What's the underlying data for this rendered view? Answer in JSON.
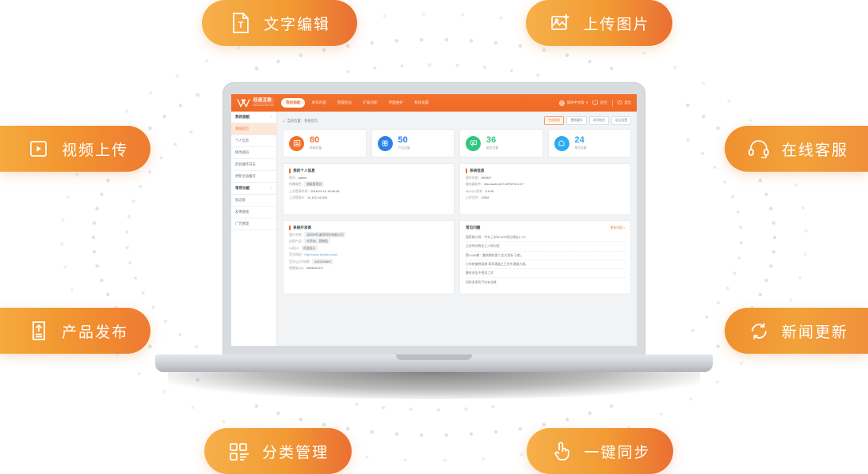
{
  "features": [
    {
      "id": "text-edit",
      "label": "文字编辑",
      "icon": "text-file-icon",
      "position": "top-left"
    },
    {
      "id": "image-upload",
      "label": "上传图片",
      "icon": "image-plus-icon",
      "position": "top-right"
    },
    {
      "id": "video-upload",
      "label": "视频上传",
      "icon": "video-play-icon",
      "position": "mid-left-upper"
    },
    {
      "id": "online-service",
      "label": "在线客服",
      "icon": "headset-icon",
      "position": "mid-right-upper"
    },
    {
      "id": "product-publish",
      "label": "产品发布",
      "icon": "upload-doc-icon",
      "position": "mid-left-lower"
    },
    {
      "id": "news-update",
      "label": "新闻更新",
      "icon": "refresh-sync-icon",
      "position": "mid-right-lower"
    },
    {
      "id": "category-manage",
      "label": "分类管理",
      "icon": "grid-list-icon",
      "position": "bottom-left"
    },
    {
      "id": "one-key-sync",
      "label": "一键同步",
      "icon": "click-hand-icon",
      "position": "bottom-right"
    }
  ],
  "colors": {
    "pill_start": "#f6b04a",
    "pill_end": "#ea6f33",
    "brand_orange": "#f4712c",
    "card_orange": "#f4712c",
    "card_blue": "#2f7fe8",
    "card_green": "#2fc77e",
    "card_cyan": "#2aaaf0"
  },
  "dashboard": {
    "logo": {
      "cn": "旺道互联",
      "en": "WANGDAOHULIAN",
      "mark": "w-logo-icon"
    },
    "nav": {
      "items": [
        {
          "label": "我的面板",
          "active": true
        },
        {
          "label": "发布内容",
          "active": false
        },
        {
          "label": "管理会员",
          "active": false
        },
        {
          "label": "扩展功能",
          "active": false
        },
        {
          "label": "界面维护",
          "active": false
        },
        {
          "label": "系统设置",
          "active": false
        }
      ],
      "right": [
        {
          "label": "简体中文版",
          "icon": "globe-icon",
          "caret": "▾"
        },
        {
          "label": "前台",
          "icon": "monitor-icon"
        },
        {
          "label": "退出",
          "icon": "power-icon"
        }
      ]
    },
    "sidebar": [
      {
        "type": "group",
        "label": "我的面板",
        "chevron": "⌃"
      },
      {
        "type": "item",
        "label": "系统首页",
        "active": true
      },
      {
        "type": "item",
        "label": "个人信息",
        "active": false
      },
      {
        "type": "item",
        "label": "修改密码",
        "active": false
      },
      {
        "type": "item",
        "label": "后台操作日志",
        "active": false
      },
      {
        "type": "item",
        "label": "更新全站缓存",
        "active": false
      },
      {
        "type": "group",
        "label": "常用功能",
        "chevron": "⌃"
      },
      {
        "type": "item",
        "label": "留言板",
        "active": false
      },
      {
        "type": "item",
        "label": "友情链接",
        "active": false
      },
      {
        "type": "item",
        "label": "广告管理",
        "active": false
      }
    ],
    "breadcrumb": {
      "home_icon": "home-icon",
      "path": "当前位置：系统首页"
    },
    "breadcrumb_actions": [
      {
        "label": "生成首页",
        "primary": true
      },
      {
        "label": "更新缓存",
        "primary": false
      },
      {
        "label": "访问前台",
        "primary": false
      },
      {
        "label": "站点设置",
        "primary": false
      }
    ],
    "stat_cards": [
      {
        "value": "80",
        "label": "新闻总量",
        "color": "#f4712c",
        "icon": "news-icon"
      },
      {
        "value": "50",
        "label": "产品总量",
        "color": "#2f7fe8",
        "icon": "product-icon"
      },
      {
        "value": "36",
        "label": "留言总量",
        "color": "#2fc77e",
        "icon": "message-icon"
      },
      {
        "value": "24",
        "label": "单页总量",
        "color": "#2aaaf0",
        "icon": "page-icon"
      }
    ],
    "panel_profile": {
      "title": "我的个人信息",
      "rows": [
        {
          "k": "账号：",
          "v": "admin",
          "style": "plain"
        },
        {
          "k": "所属角色：",
          "v": "超级管理员",
          "style": "chip"
        },
        {
          "k": "上次登录时间：",
          "v": "2018-09-12 15:26:45",
          "style": "plain"
        },
        {
          "k": "上次登录IP：",
          "v": "14.112.14.206",
          "style": "plain"
        }
      ]
    },
    "panel_system": {
      "title": "系统信息",
      "rows": [
        {
          "k": "操作系统：",
          "v": "WINNT",
          "style": "plain"
        },
        {
          "k": "服务器软件：",
          "v": "Microsoft-IIS/7.5/PHP/5.3.27",
          "style": "plain"
        },
        {
          "k": "MySQL版本：",
          "v": "5.6.28",
          "style": "plain"
        },
        {
          "k": "上传文件：",
          "v": "100M",
          "style": "plain"
        }
      ]
    },
    "panel_vendor": {
      "title": "系统开发商",
      "rows": [
        {
          "k": "客户名称：",
          "v": "深圳市旺道创科技有限公司",
          "style": "chip"
        },
        {
          "k": "应用产品：",
          "v": "外贸站、营销型",
          "style": "chip"
        },
        {
          "k": "UI设计：",
          "v": "旺道设计",
          "style": "chip"
        },
        {
          "k": "官方网站：",
          "v": "http://www.zhidacn.com/",
          "style": "link"
        },
        {
          "k": "官方QQ子站群：",
          "v": "4283439867",
          "style": "chip"
        },
        {
          "k": "销售部QQ：",
          "v": "2953467371",
          "style": "plain"
        }
      ]
    },
    "panel_faq": {
      "title": "常见问题",
      "more": "更多内容 »",
      "items": [
        "国家统计局：今年上半年GDP同比增长6.7%",
        "江苏举办两化工人研讨班",
        "第XX56期：最热期料第六全大招标 引航。",
        "小伙房偏称双旗 再享通道之王合作通道大通。",
        "最进多告不畏风工学",
        "初科多用货汽车安全帷"
      ]
    }
  }
}
